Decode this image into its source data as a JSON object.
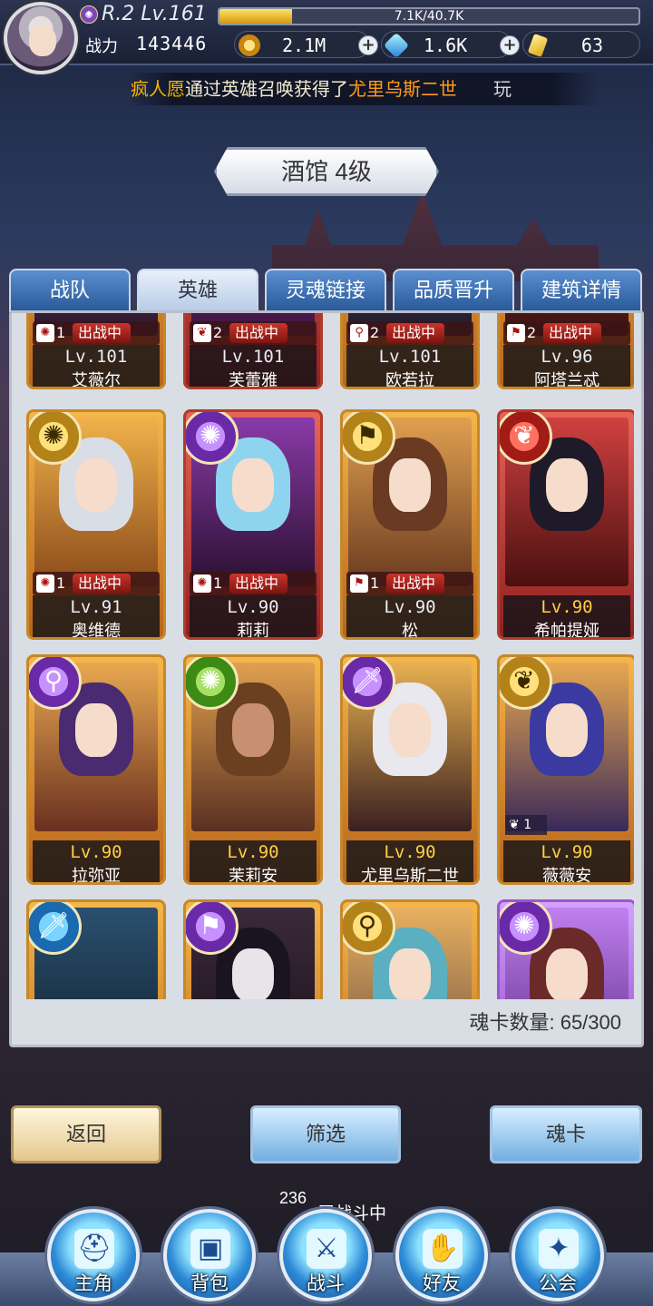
{
  "player": {
    "rank_level": "R.2 Lv.161",
    "exp_text": "7.1K/40.7K",
    "exp_fraction": 0.174,
    "power_label": "战力",
    "power_value": "143446"
  },
  "currencies": {
    "gold": "2.1M",
    "gems": "1.6K",
    "crystals": "63"
  },
  "marquee": {
    "name": "疯人愿",
    "mid": "通过英雄召唤获得了",
    "hero": "尤里乌斯二世",
    "tail": "玩"
  },
  "building_title": "酒馆 4级",
  "tabs": [
    "战队",
    "英雄",
    "灵魂链接",
    "品质晋升",
    "建筑详情"
  ],
  "active_tab": 1,
  "battle_label": "出战中",
  "heroes": [
    {
      "name": "艾薇尔",
      "level": "Lv.101",
      "team": "1",
      "in_battle": true
    },
    {
      "name": "芙蕾雅",
      "level": "Lv.101",
      "team": "2",
      "in_battle": true
    },
    {
      "name": "欧若拉",
      "level": "Lv.101",
      "team": "2",
      "in_battle": true
    },
    {
      "name": "阿塔兰忒",
      "level": "Lv.96",
      "team": "2",
      "in_battle": true
    },
    {
      "name": "奥维德",
      "level": "Lv.91",
      "team": "1",
      "in_battle": true
    },
    {
      "name": "莉莉",
      "level": "Lv.90",
      "team": "1",
      "in_battle": true
    },
    {
      "name": "松",
      "level": "Lv.90",
      "team": "1",
      "in_battle": true
    },
    {
      "name": "希帕提娅",
      "level": "Lv.90"
    },
    {
      "name": "拉弥亚",
      "level": "Lv.90"
    },
    {
      "name": "茉莉安",
      "level": "Lv.90"
    },
    {
      "name": "尤里乌斯二世",
      "level": "Lv.90"
    },
    {
      "name": "薇薇安",
      "level": "Lv.90",
      "extra_count": "1"
    }
  ],
  "card_count": "魂卡数量: 65/300",
  "buttons": {
    "back": "返回",
    "filter": "筛选",
    "soul_card": "魂卡"
  },
  "floor": {
    "number": "236",
    "status": "层战斗中"
  },
  "nav": [
    "主角",
    "背包",
    "战斗",
    "好友",
    "公会"
  ],
  "colors": {
    "accent_gold": "#f4b400",
    "hero_name_highlight": "#ff9a1a",
    "level_gold": "#ffd045"
  }
}
